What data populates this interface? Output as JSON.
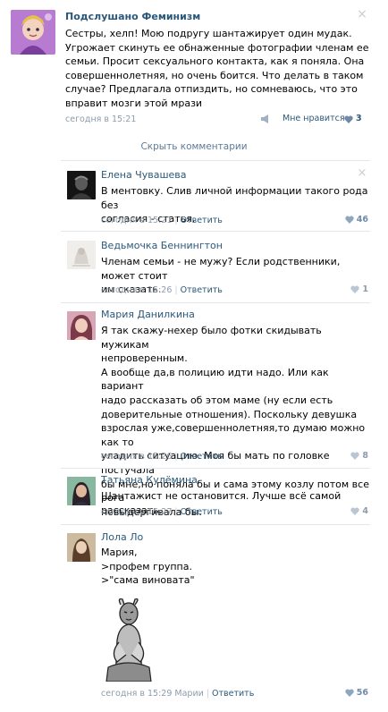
{
  "post": {
    "author": "Подслушано Феминизм",
    "text_lines": [
      "Сестры, хелп! Мою подругу шантажирует один мудак.",
      "Угрожает скинуть ее обнаженные фотографии членам ее",
      "семьи. Просит сексуального контакта, как я поняла. Она",
      "совершеннолетняя, но очень боится. Что делать в таком",
      "случае? Предлагала отпиздить, но сомневаюсь, что это",
      "вправит мозги этой мрази"
    ],
    "time": "сегодня в 15:21",
    "like_label": "Мне нравится",
    "like_count": "3",
    "close_icon": "×"
  },
  "hide_comments": "Скрыть комментарии",
  "comments": [
    {
      "name": "Елена Чувашева",
      "text": "В ментовку. Слив личной информации такого рода без\nсогласия - статья.",
      "time": "сегодня в 15:21",
      "reply": "Ответить",
      "likes": "46",
      "likes_color": "#6f8aa8"
    },
    {
      "name": "Ведьмочка Беннингтон",
      "text": "Членам семьи - не мужу? Если родственники, может стоит\nим сказать.",
      "time": "сегодня в 15:26",
      "reply": "Ответить",
      "likes": "1",
      "likes_color": "#8d9cab"
    },
    {
      "name": "Мария Данилкина",
      "text": "Я так скажу-нехер было фотки скидывать мужикам\nнепроверенным.\nА вообще да,в полицию идти надо. Или как вариант\nнадо рассказать об этом маме (ну если есть\nдоверительные отношения). Поскольку девушка\nвзрослая уже,совершеннолетняя,то думаю можно как то\nуладить ситуацию. Моя бы мать по головке постучала\nбы мне,но поняла бы и сама этому козлу потом все рога\nповыдергивала бы.",
      "time": "сегодня в 15:26",
      "reply": "Ответить",
      "likes": "8",
      "likes_color": "#8d9cab"
    },
    {
      "name": "Татьяна Кулёмина",
      "text": "Шантажист не остановится. Лучше всё самой рассказать.",
      "time": "сегодня в 15:27",
      "reply": "Ответить",
      "likes": "4",
      "likes_color": "#8d9cab"
    },
    {
      "name": "Лола Ло",
      "text": "Мария,\n>профем группа.\n>\"сама виновата\"",
      "time": "сегодня в 15:29 Марии",
      "reply": "Ответить",
      "likes": "56",
      "likes_color": "#6f8aa8"
    }
  ],
  "colors": {
    "link": "#2b587a",
    "meta": "#8d9cab",
    "separator": "#e4e8ed"
  }
}
